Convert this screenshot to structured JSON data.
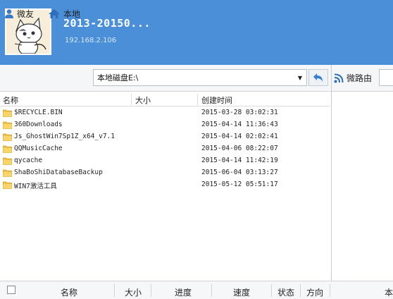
{
  "header": {
    "title": "2013-20150...",
    "ip": "192.168.2.106"
  },
  "toolbar": {
    "weiyou_label": "微友",
    "local_label": "本地",
    "path": "本地磁盘E:\\",
    "router_label": "微路由"
  },
  "list": {
    "columns": [
      "名称",
      "大小",
      "创建时间"
    ],
    "rows": [
      {
        "name": "$RECYCLE.BIN",
        "time": "2015-03-28 03:02:31"
      },
      {
        "name": "360Downloads",
        "time": "2015-04-14 11:36:43"
      },
      {
        "name": "Js_GhostWin7Sp1Z_x64_v7.1",
        "time": "2015-04-14 02:02:41"
      },
      {
        "name": "QQMusicCache",
        "time": "2015-04-06 08:22:07"
      },
      {
        "name": "qycache",
        "time": "2015-04-14 11:42:19"
      },
      {
        "name": "ShaBoShiDatabaseBackup",
        "time": "2015-06-04 03:13:27"
      },
      {
        "name": "WIN7激活工具",
        "time": "2015-05-12 05:51:17"
      }
    ]
  },
  "transfer": {
    "columns": [
      "名称",
      "大小",
      "进度",
      "速度",
      "状态",
      "方向",
      "本"
    ]
  },
  "colors": {
    "header_bg": "#4a8fd8",
    "folder": "#f1c34a",
    "accent": "#2d6fb8"
  }
}
